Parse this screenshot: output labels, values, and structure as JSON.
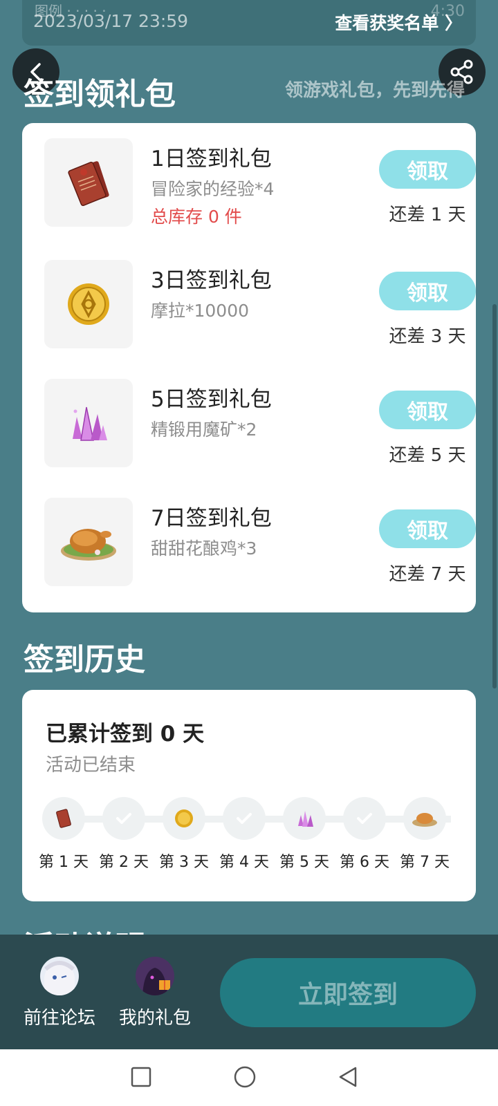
{
  "banner": {
    "ghost_text": "图例 · · · · ·",
    "date": "2023/03/17 23:59",
    "winners_link": "查看获奖名单 〉",
    "ghost_time": "4:30"
  },
  "header": {
    "title": "签到领礼包",
    "subtitle": "领游戏礼包，先到先得"
  },
  "packs": [
    {
      "name": "1日签到礼包",
      "desc": "冒险家的经验*4",
      "stock": "总库存 0 件",
      "claim_label": "领取",
      "remain": "还差 1 天",
      "icon": "experience-book-icon"
    },
    {
      "name": "3日签到礼包",
      "desc": "摩拉*10000",
      "stock": "",
      "claim_label": "领取",
      "remain": "还差 3 天",
      "icon": "mora-coin-icon"
    },
    {
      "name": "5日签到礼包",
      "desc": "精锻用魔矿*2",
      "stock": "",
      "claim_label": "领取",
      "remain": "还差 5 天",
      "icon": "crystal-ore-icon"
    },
    {
      "name": "7日签到礼包",
      "desc": "甜甜花酿鸡*3",
      "stock": "",
      "claim_label": "领取",
      "remain": "还差 7 天",
      "icon": "roast-chicken-icon"
    }
  ],
  "history": {
    "section_title": "签到历史",
    "total": "已累计签到 0 天",
    "status": "活动已结束",
    "days": [
      {
        "label": "第 1 天",
        "icon": "experience-book-icon"
      },
      {
        "label": "第 2 天",
        "icon": "check-icon"
      },
      {
        "label": "第 3 天",
        "icon": "mora-coin-icon"
      },
      {
        "label": "第 4 天",
        "icon": "check-icon"
      },
      {
        "label": "第 5 天",
        "icon": "crystal-ore-icon"
      },
      {
        "label": "第 6 天",
        "icon": "check-icon"
      },
      {
        "label": "第 7 天",
        "icon": "roast-chicken-icon"
      }
    ]
  },
  "rules": {
    "section_title": "活动说明"
  },
  "bottom": {
    "forum_label": "前往论坛",
    "gifts_label": "我的礼包",
    "signin_label": "立即签到"
  },
  "colors": {
    "background": "#4a7e88",
    "claim_button": "#8fe0e8",
    "stock_warning": "#e24b4b",
    "signin_button": "#227b82",
    "bottom_bar": "#2c4a50"
  }
}
